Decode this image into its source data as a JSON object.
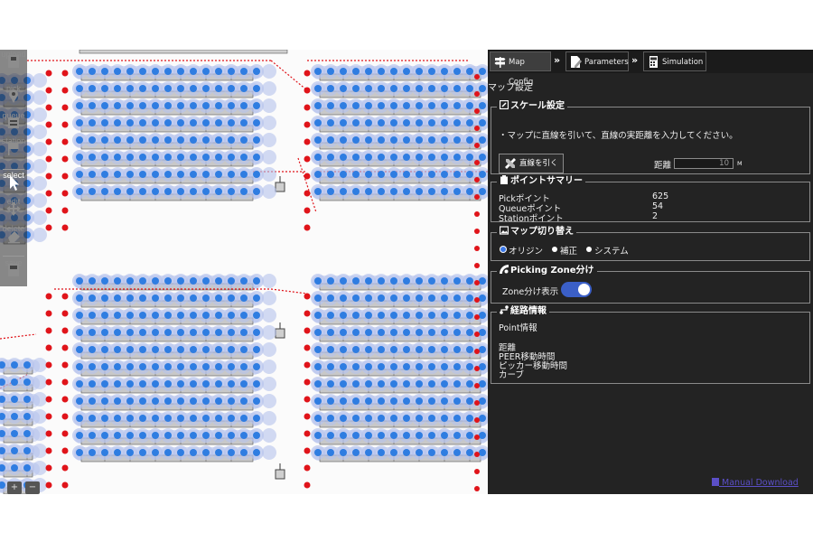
{
  "toolbar": {
    "tools": [
      {
        "label": "upload",
        "icon": "upload-icon"
      },
      {
        "label": "pick",
        "icon": "pin-icon"
      },
      {
        "label": "queue",
        "icon": "queue-icon"
      },
      {
        "label": "station",
        "icon": "flag-icon"
      },
      {
        "label": "select",
        "icon": "cursor-icon",
        "active": true
      },
      {
        "label": "edit",
        "icon": "move-icon"
      },
      {
        "label": "delete",
        "icon": "eraser-icon"
      },
      {
        "label": "save",
        "icon": "save-icon"
      }
    ],
    "zoom_in": "+",
    "zoom_out": "−"
  },
  "tabs": [
    {
      "label": "Map Config",
      "icon": "map-sign-icon",
      "active": true
    },
    {
      "label": "Parameters",
      "icon": "document-pen-icon"
    },
    {
      "label": "Simulation",
      "icon": "calculator-icon"
    }
  ],
  "panel": {
    "title": "マップ設定",
    "scale": {
      "heading": "スケール設定",
      "instruction": "・マップに直線を引いて、直線の実距離を入力してください。",
      "draw_button": "直線を引く",
      "distance_label": "距離",
      "distance_value": "10",
      "unit": "M"
    },
    "summary": {
      "heading": "ポイントサマリー",
      "rows": [
        {
          "label": "Pickポイント",
          "value": "625"
        },
        {
          "label": "Queueポイント",
          "value": "54"
        },
        {
          "label": "Stationポイント",
          "value": "2"
        }
      ]
    },
    "map_switch": {
      "heading": "マップ切り替え",
      "options": [
        {
          "label": "オリジン",
          "selected": true
        },
        {
          "label": "補正",
          "selected": false
        },
        {
          "label": "システム",
          "selected": false
        }
      ]
    },
    "zone": {
      "heading": "Picking Zone分け",
      "label": "Zone分け表示",
      "enabled": true
    },
    "route": {
      "heading": "経路情報",
      "point_info": "Point情報",
      "lines": [
        "距離",
        "PEER移動時間",
        "ピッカー移動時間",
        "カーブ"
      ]
    },
    "manual_link": "Manual Download"
  },
  "colors": {
    "panel_bg": "#232323",
    "accent": "#3b5fc7",
    "pick_point": "#2f7de1",
    "queue_point": "#e0141a",
    "zone_halo": "#b6c3ec",
    "shelf": "#c8c8c8"
  }
}
